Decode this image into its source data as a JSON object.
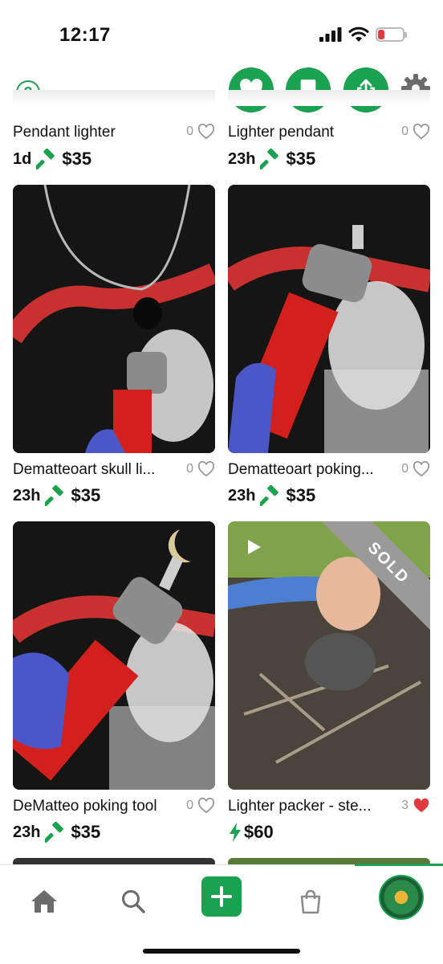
{
  "status_bar": {
    "time": "12:17",
    "battery": "9"
  },
  "header": {
    "help_icon": "question-circle-icon",
    "buttons": [
      "heart-icon",
      "bookmark-icon",
      "share-icon"
    ],
    "settings_icon": "gear-icon",
    "accent_color": "#1aa251"
  },
  "items": [
    {
      "title": "Pendant lighter",
      "likes": "0",
      "liked": false,
      "age": "1d",
      "price_type": "auction",
      "price": "$35",
      "image": "partial"
    },
    {
      "title": "Lighter pendant",
      "likes": "0",
      "liked": false,
      "age": "23h",
      "price_type": "auction",
      "price": "$35",
      "image": "partial"
    },
    {
      "title": "Dematteoart skull li...",
      "likes": "0",
      "liked": false,
      "age": "23h",
      "price_type": "auction",
      "price": "$35",
      "image": "red lighter with black skull pendant"
    },
    {
      "title": "Dematteoart poking...",
      "likes": "0",
      "liked": false,
      "age": "23h",
      "price_type": "auction",
      "price": "$35",
      "image": "red lighter with moon poker"
    },
    {
      "title": "DeMatteo poking tool",
      "likes": "0",
      "liked": false,
      "age": "23h",
      "price_type": "auction",
      "price": "$35",
      "image": "red lighter with moon poker held"
    },
    {
      "title": "Lighter packer - ste...",
      "likes": "3",
      "liked": true,
      "age": "",
      "price_type": "buy-now",
      "price": "$60",
      "image": "video",
      "badge": "SOLD"
    }
  ],
  "bottom_nav": {
    "items": [
      "home-icon",
      "search-icon",
      "add-icon",
      "bag-icon",
      "profile-avatar"
    ]
  }
}
